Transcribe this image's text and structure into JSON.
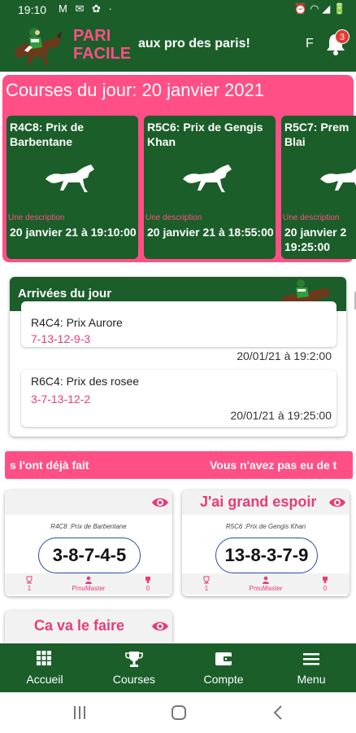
{
  "status_bar": {
    "time": "19:10",
    "notif_icons": "M ✉ ✿ ·",
    "right_icons": "⏰ ◠ ◢ 🔋"
  },
  "header": {
    "brand_line1": "PARI",
    "brand_line2": "FACILE",
    "marquee": "aux pro des paris!",
    "marquee_tail": "F",
    "badge_count": "3"
  },
  "courses": {
    "title": "Courses du jour: 20 janvier 2021",
    "cards": [
      {
        "name": "R4C8: Prix de Barbentane",
        "desc": "Une description",
        "date": "20 janvier 21 à 19:10:00"
      },
      {
        "name": "R5C6: Prix de Gengis Khan",
        "desc": "Une description",
        "date": "20 janvier 21 à 18:55:00"
      },
      {
        "name": "R5C7: Prem Blai",
        "desc": "Une description",
        "date": "20 janvier 2 19:25:00"
      }
    ]
  },
  "arrivees": {
    "title": "Arrivées du jour",
    "items": [
      {
        "name": "R4C4: Prix Aurore",
        "numbers": "7-13-12-9-3",
        "time": "20/01/21 à 19:2:00"
      },
      {
        "name": "R6C4: Prix des rosee",
        "numbers": "3-7-13-12-2",
        "time": "20/01/21 à 19:25:00"
      }
    ]
  },
  "ticker": {
    "left": "s l'ont déjà fait",
    "right": "Vous n'avez pas eu de t"
  },
  "pronostics": [
    {
      "title": "",
      "race": "R4C8 :Prix de Barbentane",
      "combo": "3-8-7-4-5",
      "left_count": "1",
      "author": "PmuMaster",
      "right_count": "0"
    },
    {
      "title": "J'ai grand espoir",
      "race": "R5C6 :Prix de Gengis Khan",
      "combo": "13-8-3-7-9",
      "left_count": "1",
      "author": "PmuMaster",
      "right_count": "0"
    },
    {
      "title": "Ca va le faire",
      "race": "",
      "combo": "",
      "left_count": "",
      "author": "",
      "right_count": ""
    }
  ],
  "bottom_nav": {
    "items": [
      {
        "label": "Accueil",
        "icon": "grid-icon"
      },
      {
        "label": "Courses",
        "icon": "trophy-icon"
      },
      {
        "label": "Compte",
        "icon": "wallet-icon"
      },
      {
        "label": "Menu",
        "icon": "hamburger-icon"
      }
    ]
  },
  "colors": {
    "green": "#1b5e2a",
    "pink": "#ff4f86",
    "pink_text": "#e83c78"
  }
}
